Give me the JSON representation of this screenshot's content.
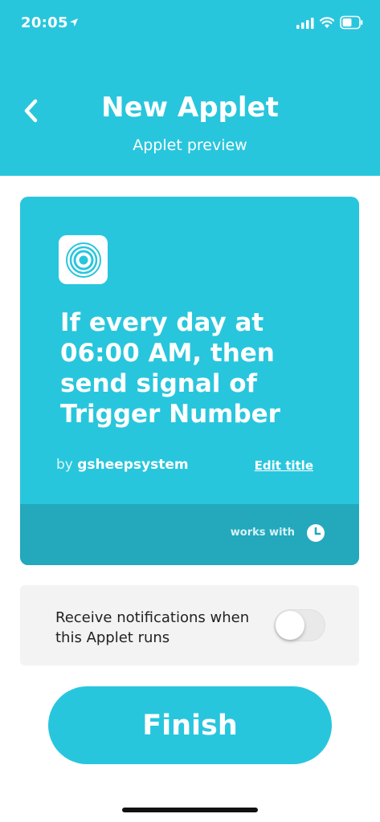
{
  "status_bar": {
    "time": "20:05"
  },
  "header": {
    "title": "New Applet",
    "subtitle": "Applet preview"
  },
  "applet": {
    "title": "If every day at 06:00 AM, then send signal of Trigger Number",
    "author_prefix": "by",
    "author_name": "gsheepsystem",
    "edit_title_label": "Edit title",
    "works_with_label": "works with"
  },
  "notifications": {
    "label": "Receive notifications when this Applet runs",
    "enabled": false
  },
  "finish_button": {
    "label": "Finish"
  },
  "colors": {
    "brand": "#28c6dd",
    "card_footer": "#23a8bc",
    "row_background": "#f3f3f3"
  },
  "icons": {
    "back": "chevron-left-icon",
    "service": "signal-rings-icon",
    "works_with": "clock-icon"
  }
}
